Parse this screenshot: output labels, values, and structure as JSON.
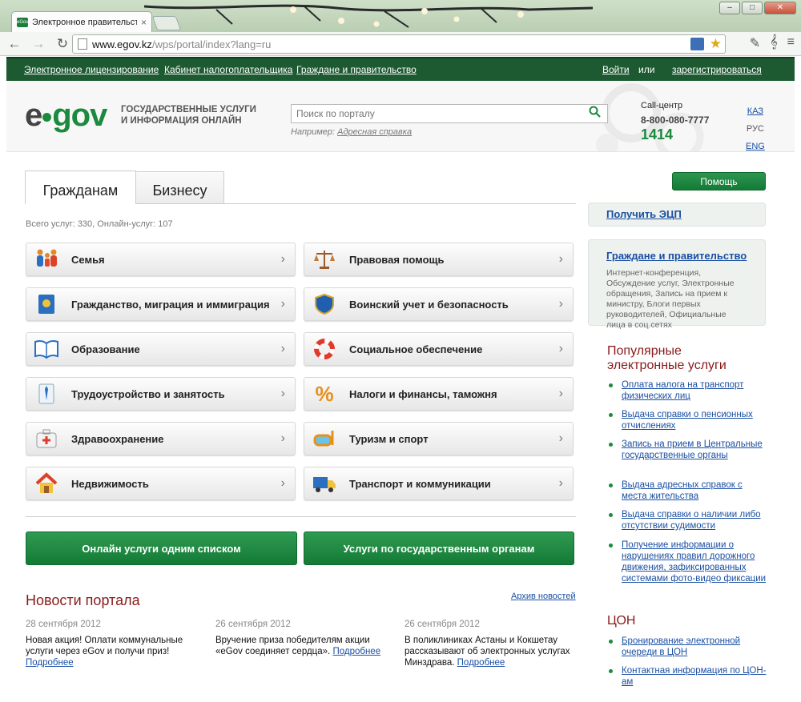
{
  "browser": {
    "tab_title": "Электронное правительство",
    "tab_favicon": "egov",
    "url_host": "www.egov.kz",
    "url_path": "/wps/portal/index?lang=ru"
  },
  "topnav": {
    "links": [
      "Электронное лицензирование",
      "Кабинет налогоплательщика",
      "Граждане и правительство"
    ],
    "login": "Войти",
    "or": "или",
    "register": "зарегистрироваться"
  },
  "header": {
    "logo_e": "e",
    "logo_gov": "gov",
    "tagline_1": "ГОСУДАРСТВЕННЫЕ УСЛУГИ",
    "tagline_2": "И ИНФОРМАЦИЯ ОНЛАЙН",
    "search_placeholder": "Поиск по порталу",
    "example_prefix": "Например:",
    "example_link": "Адресная справка",
    "call_center_label": "Call-центр",
    "call_center_phone": "8-800-080-7777",
    "call_center_short": "1414",
    "languages": [
      "КАЗ",
      "РУС",
      "ENG"
    ]
  },
  "tabs": [
    "Гражданам",
    "Бизнесу"
  ],
  "totals": "Всего услуг: 330, Онлайн-услуг: 107",
  "categories": [
    {
      "label": "Семья",
      "icon": "family-icon"
    },
    {
      "label": "Правовая помощь",
      "icon": "scales-icon"
    },
    {
      "label": "Гражданство, миграция и иммиграция",
      "icon": "passport-icon"
    },
    {
      "label": "Воинский учет и безопасность",
      "icon": "shield-icon"
    },
    {
      "label": "Образование",
      "icon": "book-icon"
    },
    {
      "label": "Социальное обеспечение",
      "icon": "lifebuoy-icon"
    },
    {
      "label": "Трудоустройство и занятость",
      "icon": "shirt-tie-icon"
    },
    {
      "label": "Налоги и финансы, таможня",
      "icon": "percent-icon"
    },
    {
      "label": "Здравоохранение",
      "icon": "medkit-icon"
    },
    {
      "label": "Туризм и спорт",
      "icon": "diving-mask-icon"
    },
    {
      "label": "Недвижимость",
      "icon": "house-icon"
    },
    {
      "label": "Транспорт и коммуникации",
      "icon": "truck-icon"
    }
  ],
  "buttons": {
    "online_list": "Онлайн услуги одним списком",
    "by_agencies": "Услуги по государственным органам"
  },
  "news": {
    "heading": "Новости портала",
    "archive": "Архив новостей",
    "more": "Подробнее",
    "items": [
      {
        "date": "28 сентября 2012",
        "text": "Новая акция! Оплати коммунальные услуги через eGov и получи приз!"
      },
      {
        "date": "26 сентября 2012",
        "text": "Вручение приза победителям акции «eGov соединяет сердца»."
      },
      {
        "date": "26 сентября 2012",
        "text": "В поликлиниках Астаны и Кокшетау рассказывают об электронных услугах Минздрава."
      }
    ]
  },
  "sidebar": {
    "help": "Помощь",
    "ecp": "Получить ЭЦП",
    "gov_link": "Граждане и правительство",
    "gov_desc": "Интернет-конференция, Обсуждение услуг, Электронные обращения, Запись на прием к министру, Блоги первых руководителей, Официальные лица в соц.сетях",
    "popular_heading": "Популярные электронные услуги",
    "popular": [
      "Оплата налога на транспорт физических лиц",
      "Выдача справки о пенсионных отчислениях",
      "Запись на прием в Центральные государственные органы",
      "Выдача адресных справок с места жительства",
      "Выдача справки о наличии либо отсутствии судимости",
      "Получение информации о нарушениях правил дорожного движения, зафиксированных системами фото-видео фиксации"
    ],
    "con_heading": "ЦОН",
    "con": [
      "Бронирование электронной очереди в ЦОН",
      "Контактная информация по ЦОН-ам"
    ]
  },
  "colors": {
    "brand_green": "#1b8a3e",
    "nav_green": "#1d5a31",
    "heading_red": "#8a1a1a",
    "link_blue": "#1a4fa3"
  }
}
